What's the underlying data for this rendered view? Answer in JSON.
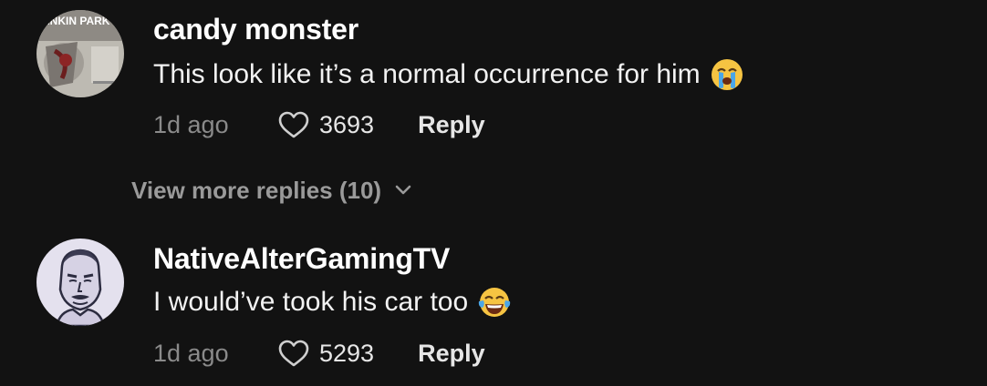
{
  "comments": [
    {
      "username": "candy monster",
      "text": "This look like it’s a normal occurrence for him",
      "emoji": "loudly-crying-face",
      "time": "1d ago",
      "likes": "3693",
      "reply_label": "Reply",
      "avatar": "album-art-avatar",
      "avatar_text": "LINKIN PARK"
    },
    {
      "username": "NativeAlterGamingTV",
      "text": "I would’ve took his car too",
      "emoji": "face-with-tears-of-joy",
      "time": "1d ago",
      "likes": "5293",
      "reply_label": "Reply",
      "avatar": "cartoon-face-avatar"
    }
  ],
  "view_more": {
    "label": "View more replies (10)",
    "icon": "chevron-down-icon"
  },
  "colors": {
    "background": "#121212",
    "username": "#ffffff",
    "muted": "#8a8a8a",
    "action": "#e6e6e6"
  }
}
